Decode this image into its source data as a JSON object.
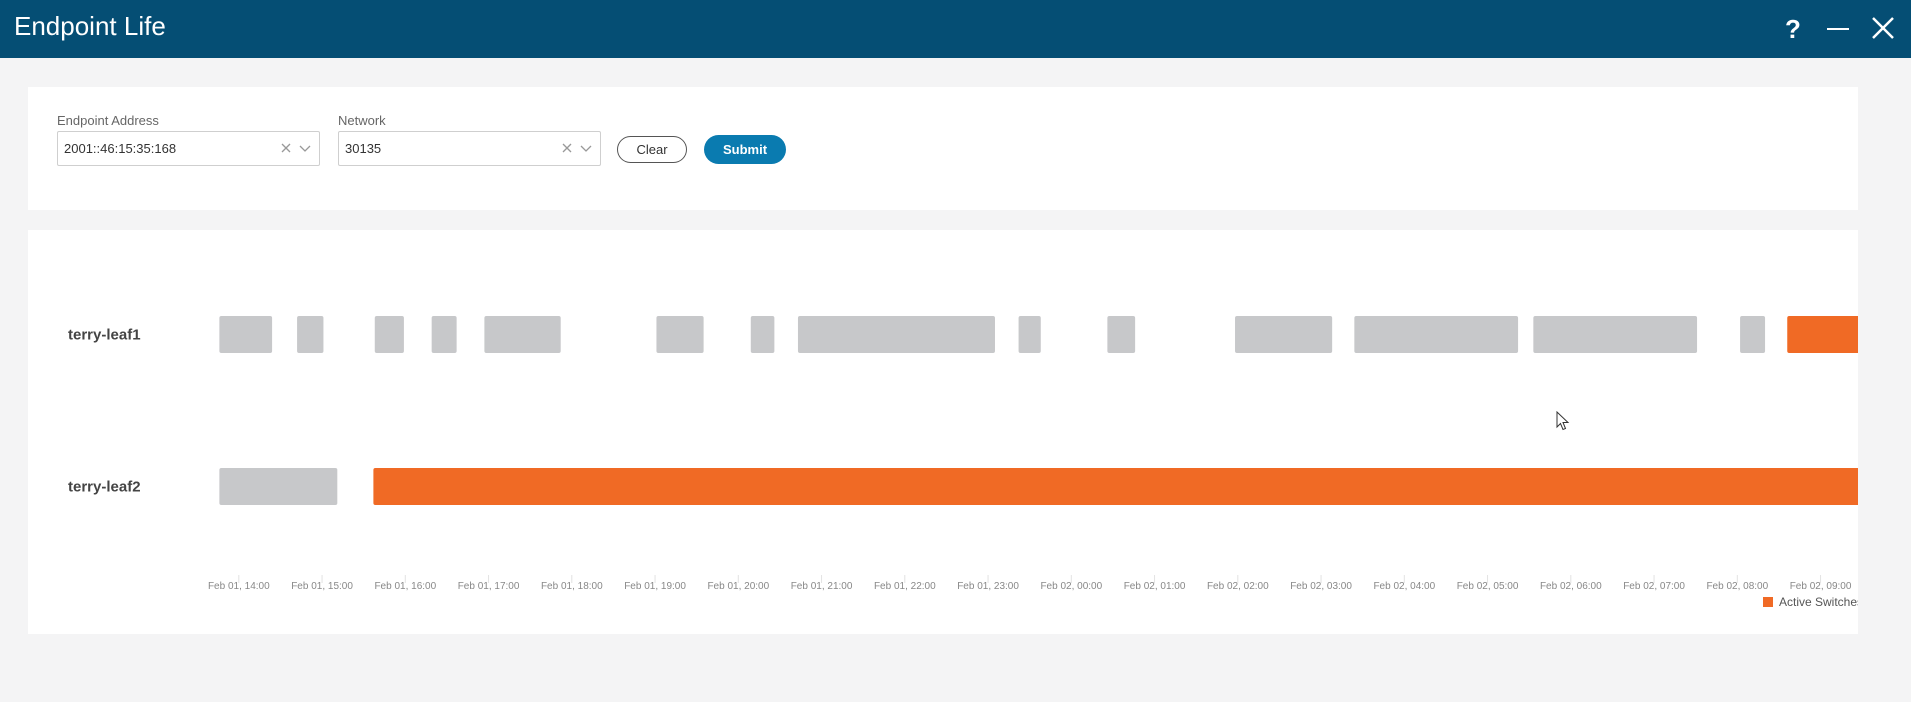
{
  "window": {
    "title": "Endpoint Life",
    "help_label": "?",
    "minimize_icon": "minimize-icon",
    "close_icon": "close-icon"
  },
  "filters": {
    "endpoint_address": {
      "label": "Endpoint Address",
      "value": "2001::46:15:35:168"
    },
    "network": {
      "label": "Network",
      "value": "30135"
    },
    "clear_label": "Clear",
    "submit_label": "Submit"
  },
  "colors": {
    "header": "#054e74",
    "active": "#f06a25",
    "inactive": "#c7c8ca",
    "submit": "#0a7bb0"
  },
  "chart_data": {
    "type": "timeline",
    "xlabel": "",
    "ylabel": "",
    "x_range": [
      "Feb 01, 13:36",
      "Feb 02, 09:38"
    ],
    "ticks": [
      "Feb 01, 14:00",
      "Feb 01, 15:00",
      "Feb 01, 16:00",
      "Feb 01, 17:00",
      "Feb 01, 18:00",
      "Feb 01, 19:00",
      "Feb 01, 20:00",
      "Feb 01, 21:00",
      "Feb 01, 22:00",
      "Feb 01, 23:00",
      "Feb 02, 00:00",
      "Feb 02, 01:00",
      "Feb 02, 02:00",
      "Feb 02, 03:00",
      "Feb 02, 04:00",
      "Feb 02, 05:00",
      "Feb 02, 06:00",
      "Feb 02, 07:00",
      "Feb 02, 08:00",
      "Feb 02, 09:00",
      "Feb 02, ..."
    ],
    "rows": [
      {
        "name": "terry-leaf1",
        "segments": [
          {
            "start": "Feb 01, 13:46",
            "end": "Feb 01, 14:24",
            "active": false
          },
          {
            "start": "Feb 01, 14:42",
            "end": "Feb 01, 15:01",
            "active": false
          },
          {
            "start": "Feb 01, 15:38",
            "end": "Feb 01, 15:59",
            "active": false
          },
          {
            "start": "Feb 01, 16:19",
            "end": "Feb 01, 16:37",
            "active": false
          },
          {
            "start": "Feb 01, 16:57",
            "end": "Feb 01, 17:52",
            "active": false
          },
          {
            "start": "Feb 01, 19:01",
            "end": "Feb 01, 19:35",
            "active": false
          },
          {
            "start": "Feb 01, 20:09",
            "end": "Feb 01, 20:26",
            "active": false
          },
          {
            "start": "Feb 01, 20:43",
            "end": "Feb 01, 23:05",
            "active": false
          },
          {
            "start": "Feb 01, 23:22",
            "end": "Feb 01, 23:38",
            "active": false
          },
          {
            "start": "Feb 02, 00:26",
            "end": "Feb 02, 00:46",
            "active": false
          },
          {
            "start": "Feb 02, 01:58",
            "end": "Feb 02, 03:08",
            "active": false
          },
          {
            "start": "Feb 02, 03:24",
            "end": "Feb 02, 05:22",
            "active": false
          },
          {
            "start": "Feb 02, 05:33",
            "end": "Feb 02, 07:31",
            "active": false
          },
          {
            "start": "Feb 02, 08:02",
            "end": "Feb 02, 08:20",
            "active": false
          },
          {
            "start": "Feb 02, 08:36",
            "end": "Feb 02, 09:51",
            "active": true
          }
        ]
      },
      {
        "name": "terry-leaf2",
        "segments": [
          {
            "start": "Feb 01, 13:46",
            "end": "Feb 01, 15:11",
            "active": false
          },
          {
            "start": "Feb 01, 15:37",
            "end": "Feb 02, 09:51",
            "active": true
          }
        ]
      }
    ],
    "legend": [
      {
        "label": "Active Switches",
        "color": "#f06a25"
      }
    ],
    "legend_position": "bottom-right"
  }
}
